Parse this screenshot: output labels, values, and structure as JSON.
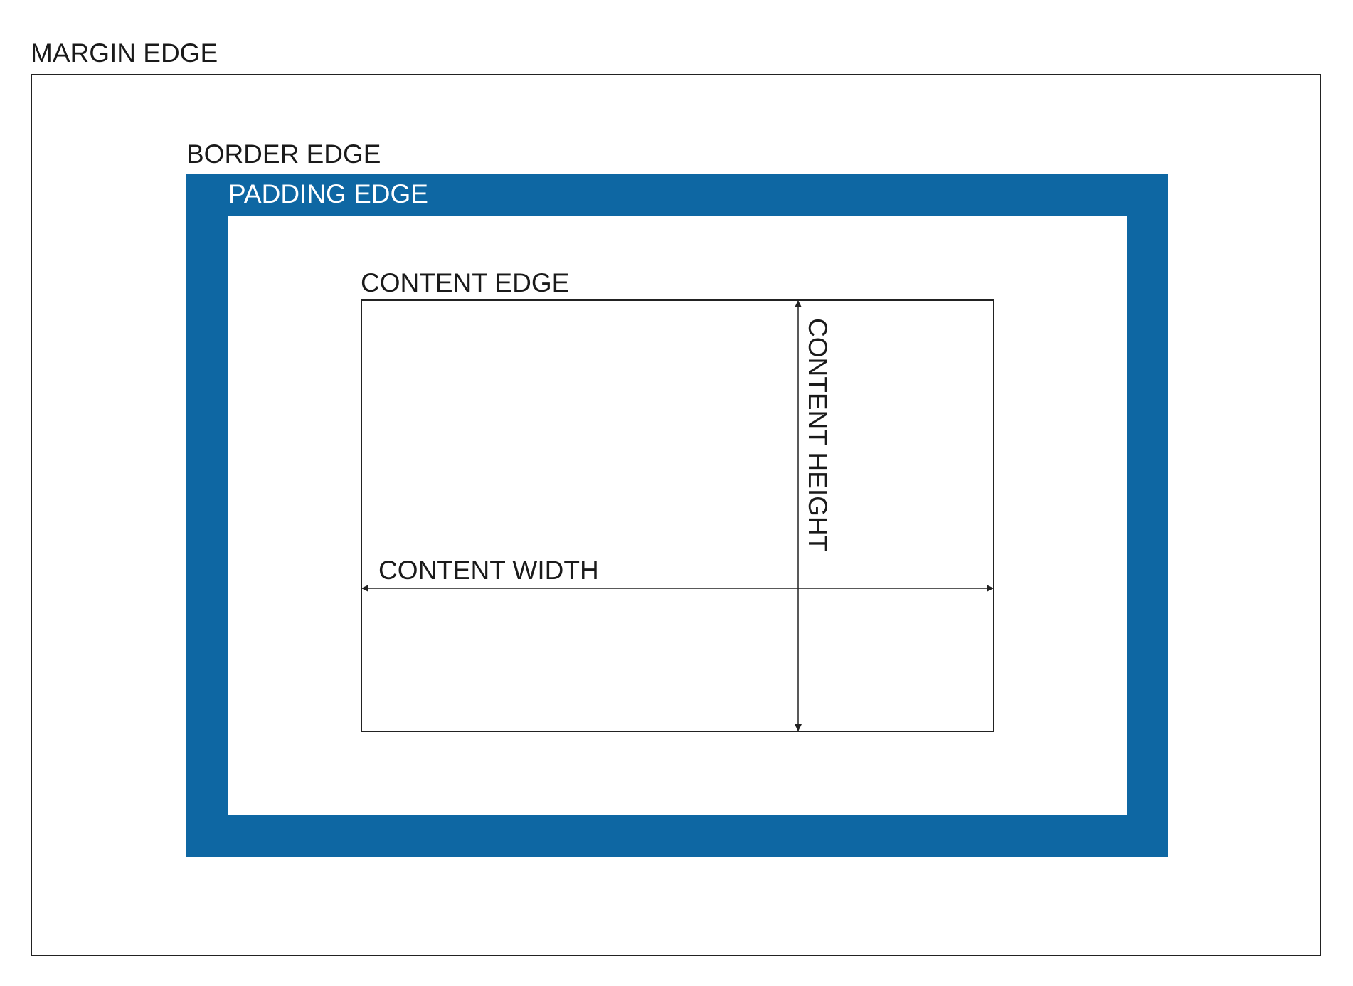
{
  "labels": {
    "margin_edge": "MARGIN EDGE",
    "border_edge": "BORDER EDGE",
    "padding_edge": "PADDING EDGE",
    "content_edge": "CONTENT EDGE",
    "content_width": "CONTENT WIDTH",
    "content_height": "CONTENT HEIGHT"
  },
  "colors": {
    "border_fill": "#0e67a3",
    "outline": "#222222",
    "text": "#1a1a1a",
    "padding_label": "#ffffff"
  }
}
